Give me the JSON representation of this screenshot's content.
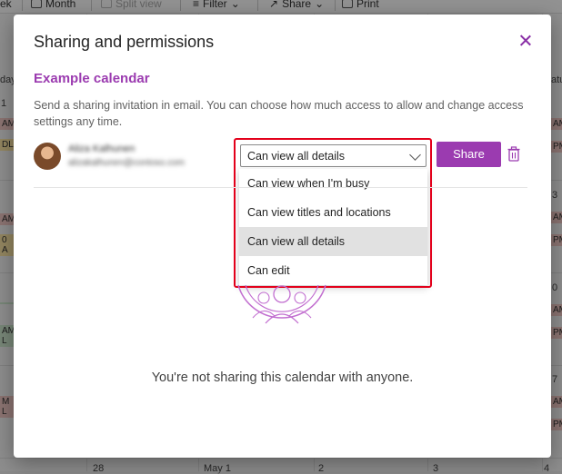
{
  "toolbar": {
    "view_week_partial": "ek",
    "view_month": "Month",
    "split_view": "Split view",
    "filter": "Filter",
    "share": "Share",
    "print": "Print"
  },
  "background": {
    "left_labels": [
      "day",
      "1",
      "AM",
      "DL",
      "AM",
      "0 A",
      "AM L",
      "M L"
    ],
    "right_labels": [
      "atu",
      "AM",
      "PM",
      "3",
      "AM",
      "PM",
      "0",
      "AM",
      "PM",
      "7",
      "AM",
      "PM"
    ],
    "bottom_labels": [
      "28",
      "May 1",
      "2",
      "3",
      "4"
    ]
  },
  "dialog": {
    "title": "Sharing and permissions",
    "calendar_name": "Example calendar",
    "description": "Send a sharing invitation in email. You can choose how much access to allow and change access settings any time.",
    "contact": {
      "name": "Aliza Kalhunen",
      "email": "alizakalhunen@contoso.com"
    },
    "permission_select": {
      "value": "Can view all details",
      "options": [
        "Can view when I'm busy",
        "Can view titles and locations",
        "Can view all details",
        "Can edit"
      ],
      "selected_index": 2
    },
    "share_label": "Share",
    "empty_message": "You're not sharing this calendar with anyone.",
    "accent_color": "#9b3bb0",
    "highlight_color": "#e3001b"
  }
}
